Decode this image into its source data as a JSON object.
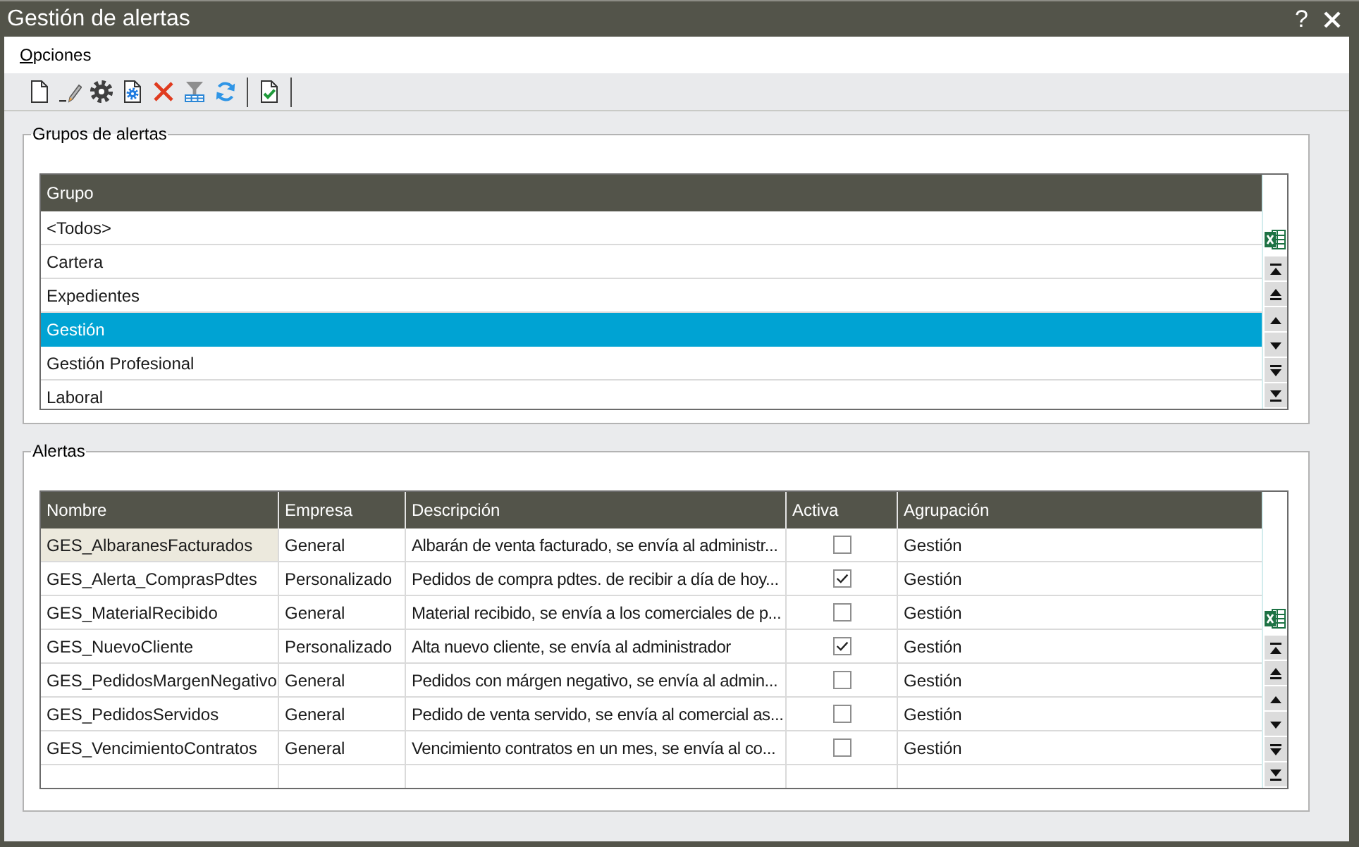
{
  "window": {
    "title": "Gestión de alertas",
    "help": "?"
  },
  "menu": [
    {
      "label": "Opciones"
    }
  ],
  "groups": {
    "title": "Grupos de alertas",
    "columns": [
      "Grupo"
    ],
    "rows": [
      {
        "name": "<Todos>",
        "selected": false
      },
      {
        "name": "Cartera",
        "selected": false
      },
      {
        "name": "Expedientes",
        "selected": false
      },
      {
        "name": "Gestión",
        "selected": true
      },
      {
        "name": "Gestión Profesional",
        "selected": false
      },
      {
        "name": "Laboral",
        "selected": false
      }
    ]
  },
  "alerts": {
    "title": "Alertas",
    "columns": [
      "Nombre",
      "Empresa",
      "Descripción",
      "Activa",
      "Agrupación"
    ],
    "rows": [
      {
        "name": "GES_AlbaranesFacturados",
        "company": "General",
        "description": "Albarán de venta facturado, se envía al administr...",
        "active": false,
        "group": "Gestión",
        "selected": true
      },
      {
        "name": "GES_Alerta_ComprasPdtes",
        "company": "Personalizado",
        "description": "Pedidos de compra pdtes. de recibir a día de hoy...",
        "active": true,
        "group": "Gestión",
        "selected": false
      },
      {
        "name": "GES_MaterialRecibido",
        "company": "General",
        "description": "Material recibido, se envía a los comerciales de p...",
        "active": false,
        "group": "Gestión",
        "selected": false
      },
      {
        "name": "GES_NuevoCliente",
        "company": "Personalizado",
        "description": "Alta nuevo cliente, se envía al administrador",
        "active": true,
        "group": "Gestión",
        "selected": false
      },
      {
        "name": "GES_PedidosMargenNegativo",
        "company": "General",
        "description": "Pedidos con márgen negativo, se envía al admin...",
        "active": false,
        "group": "Gestión",
        "selected": false
      },
      {
        "name": "GES_PedidosServidos",
        "company": "General",
        "description": "Pedido de venta servido, se envía al comercial as...",
        "active": false,
        "group": "Gestión",
        "selected": false
      },
      {
        "name": "GES_VencimientoContratos",
        "company": "General",
        "description": "Vencimiento contratos en un mes, se envía al co...",
        "active": false,
        "group": "Gestión",
        "selected": false
      }
    ]
  }
}
